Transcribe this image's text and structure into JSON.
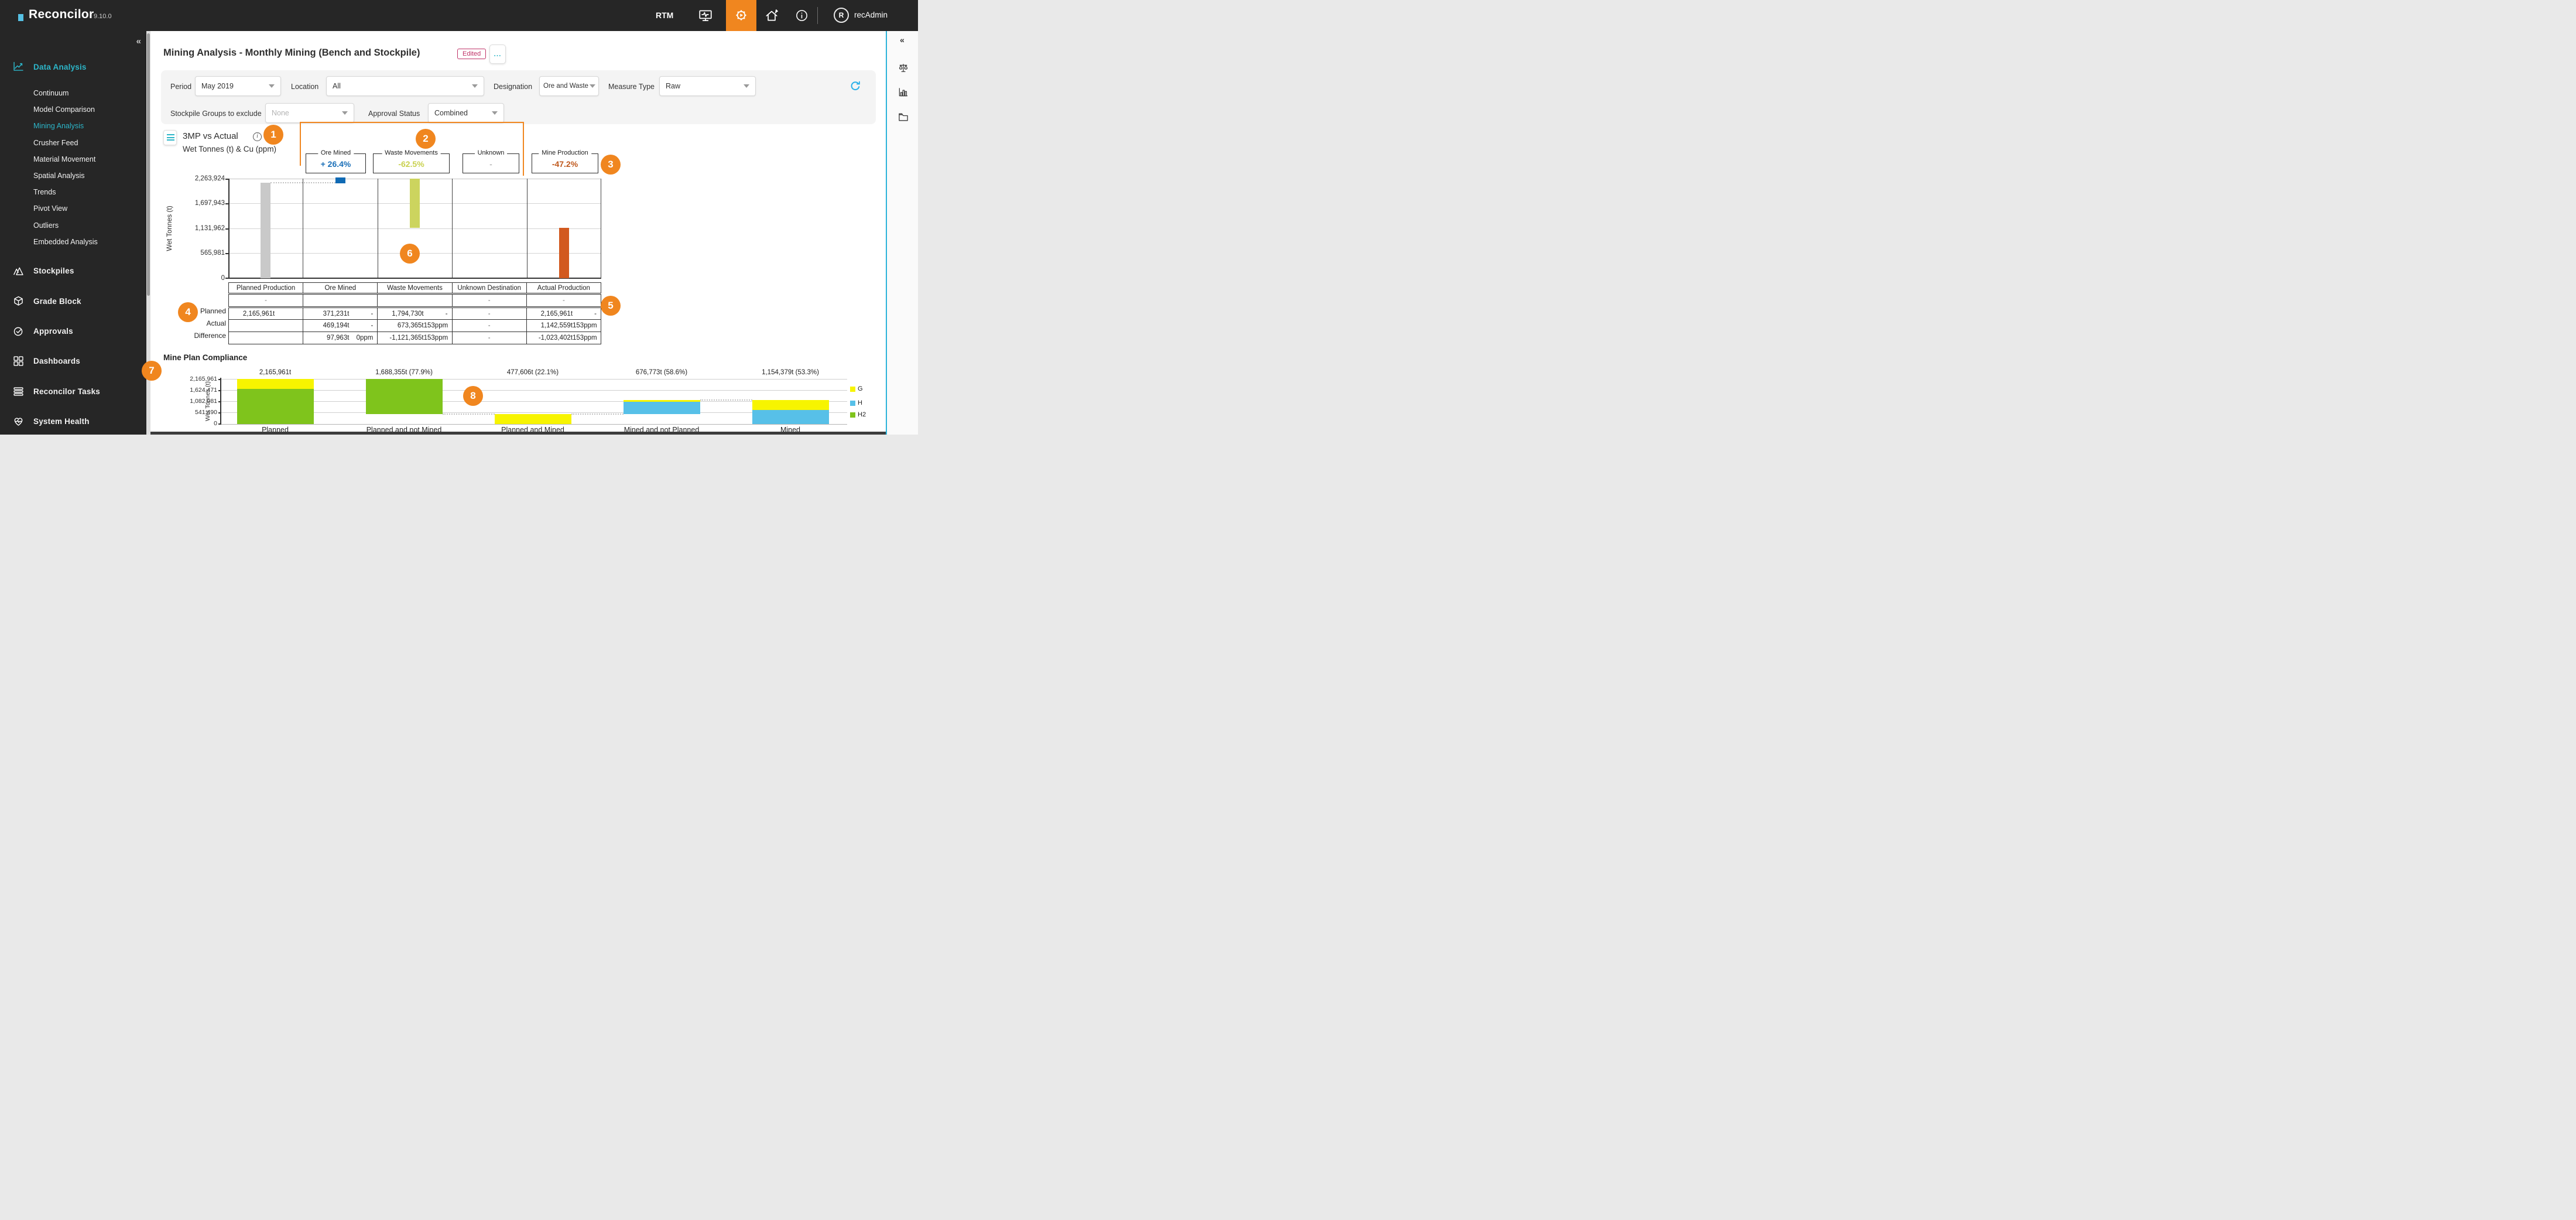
{
  "header": {
    "brand": "Reconcilor",
    "version": "9.10.0",
    "rtm": "RTM",
    "user": "recAdmin",
    "avatar_initial": "R"
  },
  "sidebar": {
    "collapse": "«",
    "primary": {
      "label": "Data Analysis"
    },
    "children": [
      "Continuum",
      "Model Comparison",
      "Mining Analysis",
      "Crusher Feed",
      "Material Movement",
      "Spatial Analysis",
      "Trends",
      "Pivot View",
      "Outliers",
      "Embedded Analysis"
    ],
    "sections": [
      "Stockpiles",
      "Grade Block",
      "Approvals",
      "Dashboards",
      "Reconcilor Tasks",
      "System Health"
    ],
    "accent_color": "#2cb5c8"
  },
  "right_panel": {
    "collapse": "«"
  },
  "page": {
    "title": "Mining Analysis - Monthly Mining (Bench and Stockpile)",
    "badge": "Edited",
    "more": "..."
  },
  "filters": {
    "period_label": "Period",
    "period_value": "May 2019",
    "location_label": "Location",
    "location_value": "All",
    "designation_label": "Designation",
    "designation_value": "Ore and Waste",
    "measure_label": "Measure Type",
    "measure_value": "Raw",
    "stockpile_label": "Stockpile Groups to exclude",
    "stockpile_value": "None",
    "approval_label": "Approval Status",
    "approval_value": "Combined"
  },
  "chart1": {
    "title": "3MP vs Actual",
    "subtitle": "Wet Tonnes (t) & Cu (ppm)",
    "ylabel": "Wet Tonnes (t)",
    "yticks": [
      "2,263,924",
      "1,697,943",
      "1,131,962",
      "565,981",
      "0"
    ],
    "boxes": [
      {
        "label": "Ore Mined",
        "value": "+ 26.4%",
        "color": "#1a6fb8"
      },
      {
        "label": "Waste Movements",
        "value": "-62.5%",
        "color": "#c9d14f"
      },
      {
        "label": "Unknown",
        "value": "-",
        "color": "#9a9a9a"
      },
      {
        "label": "Mine Production",
        "value": "-47.2%",
        "color": "#c05a1f"
      }
    ]
  },
  "table": {
    "headers": [
      "Planned Production",
      "Ore Mined",
      "Waste Movements",
      "Unknown Destination",
      "Actual Production"
    ],
    "sub": [
      "-",
      "",
      "",
      "-",
      "-"
    ],
    "row_labels": [
      "Planned",
      "Actual",
      "Difference"
    ],
    "planned": {
      "c0": "2,165,961t",
      "c1t": "371,231t",
      "c1g": "-",
      "c2t": "1,794,730t",
      "c2g": "-",
      "c3": "-",
      "c4t": "2,165,961t",
      "c4g": "-"
    },
    "actual": {
      "c0": "",
      "c1t": "469,194t",
      "c1g": "-",
      "c2t": "673,365t",
      "c2g": "153ppm",
      "c3": "-",
      "c4t": "1,142,559t",
      "c4g": "153ppm"
    },
    "difference": {
      "c0": "",
      "c1t": "97,963t",
      "c1g": "0ppm",
      "c2t": "-1,121,365t",
      "c2g": "153ppm",
      "c3": "-",
      "c4t": "-1,023,402t",
      "c4g": "153ppm"
    }
  },
  "compliance": {
    "title": "Mine Plan Compliance",
    "ylabel": "Wet Tonnes (t)",
    "yticks": [
      "2,165,961",
      "1,624,471",
      "1,082,981",
      "541,490",
      "0"
    ],
    "value_labels": [
      "2,165,961t",
      "1,688,355t (77.9%)",
      "477,606t (22.1%)",
      "676,773t (58.6%)",
      "1,154,379t (53.3%)"
    ],
    "xlabels": [
      "Planned",
      "Planned and not Mined",
      "Planned and Mined",
      "Mined and not Planned",
      "Mined"
    ],
    "legend": [
      {
        "label": "G",
        "color": "#f7f400"
      },
      {
        "label": "H",
        "color": "#57c0e8"
      },
      {
        "label": "H2",
        "color": "#7fc41c"
      }
    ]
  },
  "annotations": {
    "labels": [
      "1",
      "2",
      "3",
      "4",
      "5",
      "6",
      "7",
      "8"
    ],
    "color": "#f0861f"
  },
  "chart_data": [
    {
      "type": "bar",
      "subtype": "waterfall",
      "title": "3MP vs Actual",
      "subtitle": "Wet Tonnes (t) & Cu (ppm)",
      "ylabel": "Wet Tonnes (t)",
      "ylim": [
        0,
        2263924
      ],
      "yticks": [
        2263924,
        1697943,
        1131962,
        565981,
        0
      ],
      "categories": [
        "Planned Production",
        "Ore Mined",
        "Waste Movements",
        "Unknown Destination",
        "Actual Production"
      ],
      "bars": [
        {
          "category": "Planned Production",
          "from": 0,
          "to": 2165961,
          "color": "#c9c9c9"
        },
        {
          "category": "Ore Mined",
          "from": 2165961,
          "to": 2263924,
          "color": "#0f6ab4"
        },
        {
          "category": "Waste Movements",
          "from": 1142559,
          "to": 2263924,
          "color": "#ccd45e"
        },
        {
          "category": "Unknown Destination",
          "from": null,
          "to": null,
          "color": null
        },
        {
          "category": "Actual Production",
          "from": 0,
          "to": 1142559,
          "color": "#d2591f"
        }
      ],
      "grid": true
    },
    {
      "type": "bar",
      "subtype": "stacked-floating",
      "title": "Mine Plan Compliance",
      "ylabel": "Wet Tonnes (t)",
      "ylim": [
        0,
        2165961
      ],
      "yticks": [
        2165961,
        1624471,
        1082981,
        541490,
        0
      ],
      "categories": [
        "Planned",
        "Planned and not Mined",
        "Planned and Mined",
        "Mined and not Planned",
        "Mined"
      ],
      "value_labels": [
        "2,165,961t",
        "1,688,355t (77.9%)",
        "477,606t (22.1%)",
        "676,773t (58.6%)",
        "1,154,379t (53.3%)"
      ],
      "legend": [
        "G",
        "H",
        "H2"
      ],
      "legend_position": "right",
      "series_segments": [
        {
          "category": "Planned",
          "segments": [
            {
              "name": "H2",
              "from": 0,
              "to": 1688355,
              "color": "#7fc41c"
            },
            {
              "name": "G",
              "from": 1688355,
              "to": 2165961,
              "color": "#f7f400"
            }
          ]
        },
        {
          "category": "Planned and not Mined",
          "segments": [
            {
              "name": "H2",
              "from": 477606,
              "to": 2165961,
              "color": "#7fc41c"
            }
          ]
        },
        {
          "category": "Planned and Mined",
          "segments": [
            {
              "name": "G",
              "from": 0,
              "to": 477606,
              "color": "#f7f400"
            }
          ]
        },
        {
          "category": "Mined and not Planned",
          "segments": [
            {
              "name": "H",
              "from": 477606,
              "to": 1100000,
              "color": "#57c0e8"
            },
            {
              "name": "G",
              "from": 1100000,
              "to": 1154379,
              "color": "#f7f400"
            }
          ]
        },
        {
          "category": "Mined",
          "segments": [
            {
              "name": "H",
              "from": 0,
              "to": 676773,
              "color": "#57c0e8"
            },
            {
              "name": "G",
              "from": 676773,
              "to": 1154379,
              "color": "#f7f400"
            }
          ]
        }
      ],
      "grid": true
    }
  ]
}
